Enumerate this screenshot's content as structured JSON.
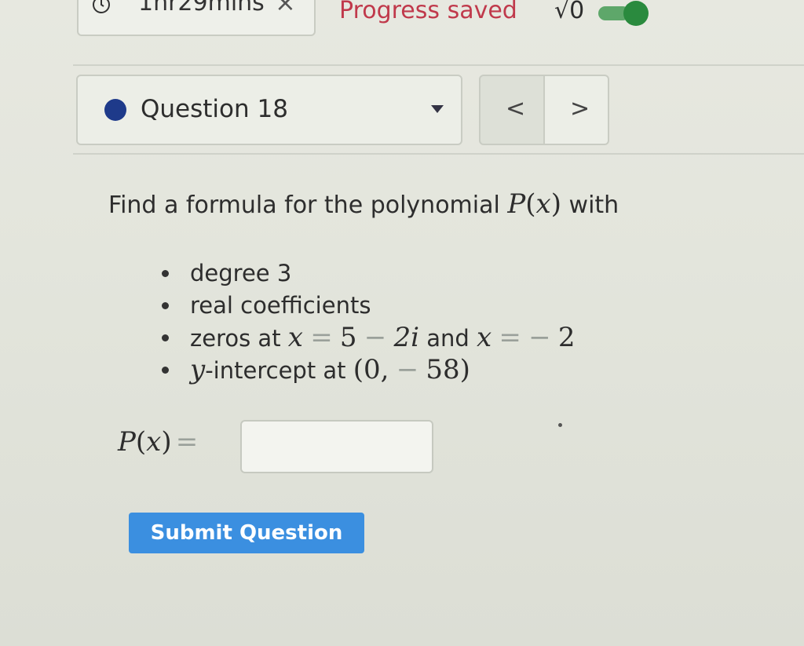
{
  "header": {
    "timer_icon": "clock-icon",
    "timer_text": "1hr29mins",
    "timer_close_symbol": "×",
    "progress_status": "Progress saved",
    "vo_text": "√0",
    "toggle_icon": "toggle-switch",
    "toggle_color": "#2a8a3e"
  },
  "question_nav": {
    "label": "Question 18",
    "status_color": "#1e3a8a",
    "prev_symbol": "<",
    "next_symbol": ">"
  },
  "problem": {
    "prompt_prefix": "Find a formula for the polynomial",
    "prompt_fn": "P",
    "prompt_open": "(",
    "prompt_var": "x",
    "prompt_close": ")",
    "prompt_suffix": "with",
    "conditions": {
      "c1": "degree 3",
      "c2": "real coefficients",
      "c3_prefix": "zeros at",
      "c3_x1": "x",
      "c3_eq1": "=",
      "c3_val1": "5",
      "c3_minus": "−",
      "c3_val2": "2i",
      "c3_and": "and",
      "c3_x2": "x",
      "c3_eq2": "=",
      "c3_neg": "−",
      "c3_val3": "2",
      "c4_var": "y",
      "c4_suffix": "-intercept at",
      "c4_open": "(0,",
      "c4_neg": "−",
      "c4_close": "58)"
    },
    "answer_fn": "P",
    "answer_open": "(",
    "answer_var": "x",
    "answer_close": ")",
    "answer_eq": "=",
    "answer_value": ""
  },
  "actions": {
    "submit_label": "Submit Question",
    "submit_color": "#3b8fe0"
  }
}
